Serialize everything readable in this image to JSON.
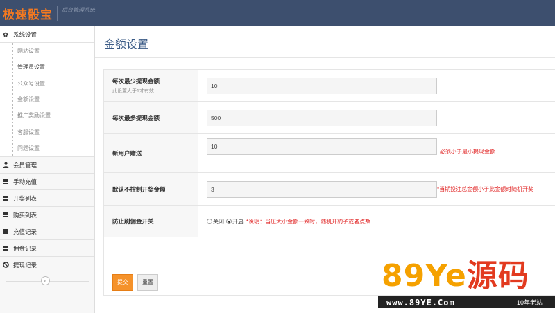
{
  "header": {
    "title": "极速骰宝",
    "subtitle": "后台管理系统"
  },
  "sidebar": {
    "groups": [
      {
        "label": "系统设置",
        "icon": "gear-icon",
        "open": true,
        "items": [
          {
            "label": "网站设置"
          },
          {
            "label": "管理员设置",
            "active": true
          },
          {
            "label": "公众号设置"
          },
          {
            "label": "金额设置"
          },
          {
            "label": "推广奖励设置"
          },
          {
            "label": "客服设置"
          },
          {
            "label": "问题设置"
          }
        ]
      },
      {
        "label": "会员管理",
        "icon": "user-icon"
      },
      {
        "label": "手动充值",
        "icon": "list-icon"
      },
      {
        "label": "开奖列表",
        "icon": "list-icon"
      },
      {
        "label": "购买列表",
        "icon": "list-icon"
      },
      {
        "label": "充值记录",
        "icon": "list-icon"
      },
      {
        "label": "佣金记录",
        "icon": "list-icon"
      },
      {
        "label": "提现记录",
        "icon": "ban-icon"
      }
    ],
    "collapse_glyph": "«"
  },
  "main": {
    "page_title": "金额设置",
    "form": {
      "rows": [
        {
          "label": "每次最少提现金额",
          "hint": "此设置大于1才有效",
          "value": "10",
          "note": ""
        },
        {
          "label": "每次最多提现金额",
          "hint": "",
          "value": "500",
          "note": ""
        },
        {
          "label": "新用户赠送",
          "hint": "",
          "value": "10",
          "note": "必须小于最小提现金额"
        },
        {
          "label": "默认不控制开奖金额",
          "hint": "",
          "value": "3",
          "note": "*当期投注总金额小于此金额时随机开奖"
        },
        {
          "label": "防止刷佣金开关",
          "hint": "",
          "radio": {
            "off": "关闭",
            "on": "开启",
            "selected": "on"
          },
          "note": "*说明：当压大小金额一致时，随机开豹子或者点数"
        }
      ],
      "submit_label": "提交",
      "reset_label": "重置"
    }
  },
  "watermark": {
    "logo_digits": "89",
    "logo_ye": "Ye",
    "logo_cn": "源码",
    "url": "www.89YE.Com",
    "tag": "10年老站"
  }
}
